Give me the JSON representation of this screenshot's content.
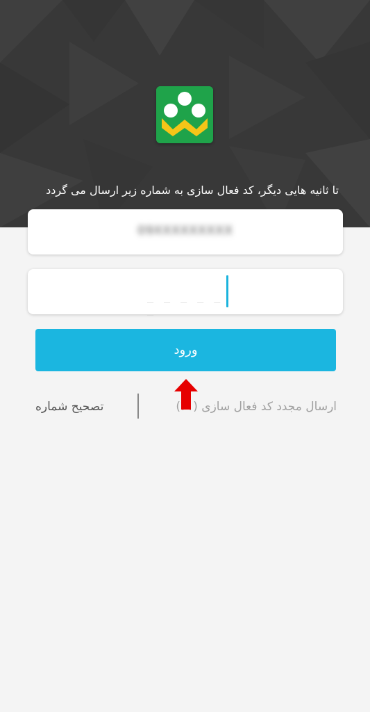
{
  "header": {
    "background_color": "#3a3a3a",
    "logo_icon": "app-logo-icon",
    "logo_color": "#1fa34a",
    "info_text": "تا ثانیه هایی دیگر، کد فعال سازی به شماره زیر ارسال می گردد"
  },
  "phone": {
    "value": "09XXXXXXXXX"
  },
  "code": {
    "value": "",
    "placeholder": "_ _ _ _ _ _",
    "accent_color": "#1ab3dd"
  },
  "login": {
    "label": "ورود",
    "color": "#1bb6e0"
  },
  "links": {
    "resend": "ارسال مجدد کد فعال سازی (۴۱)",
    "fix_number": "تصحیح شماره"
  },
  "annotation": {
    "icon": "red-arrow-up-icon",
    "color": "#e60000"
  }
}
